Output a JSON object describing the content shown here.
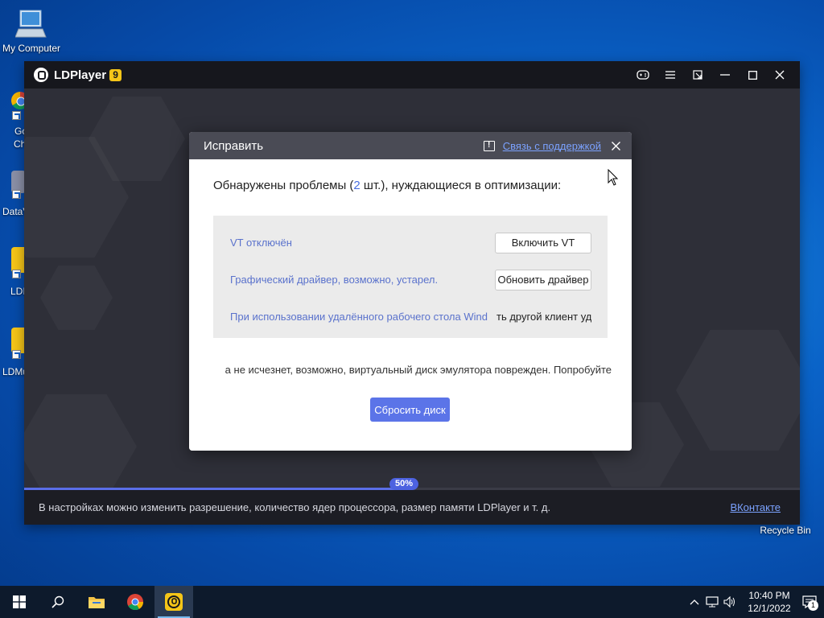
{
  "desktop": {
    "my_computer_label": "My Computer",
    "recycle_bin_label": "Recycle Bin",
    "partial_icons": [
      {
        "line1": "Go",
        "line2": "Ch"
      },
      {
        "line1": "DataV",
        "line2": ""
      },
      {
        "line1": "LDI",
        "line2": ""
      },
      {
        "line1": "LDMu",
        "line2": ""
      }
    ]
  },
  "ld_window": {
    "title": "LDPlayer",
    "version_badge": "9",
    "progress_percent": 50,
    "progress_label": "50%",
    "footer_tip": "В настройках можно изменить разрешение, количество ядер процессора, размер памяти LDPlayer и т. д.",
    "footer_link": "ВКонтакте"
  },
  "dialog": {
    "title": "Исправить",
    "support_link": "Связь с поддержкой",
    "question_prefix": "Обнаружены проблемы (",
    "question_count": "2",
    "question_suffix": " шт.), нуждающиеся в оптимизации:",
    "issues": [
      {
        "text": "VT отключён",
        "button": "Включить VT"
      },
      {
        "text": "Графический драйвер, возможно, устарел.",
        "button": "Обновить драйвер"
      }
    ],
    "issue3_part1": "При использовании удалённого рабочего стола Wind",
    "issue3_part2": "ть другой клиент уд",
    "disk_text": "а не исчезнет, возможно, виртуальный диск эмулятора поврежден. Попробуйте",
    "reset_button": "Сбросить диск"
  },
  "taskbar": {
    "time": "10:40 PM",
    "date": "12/1/2022",
    "notification_count": "1"
  },
  "colors": {
    "accent": "#5b74e8",
    "link": "#7ba2ff",
    "issue_text": "#5a72cc",
    "badge_yellow": "#f5c518"
  }
}
